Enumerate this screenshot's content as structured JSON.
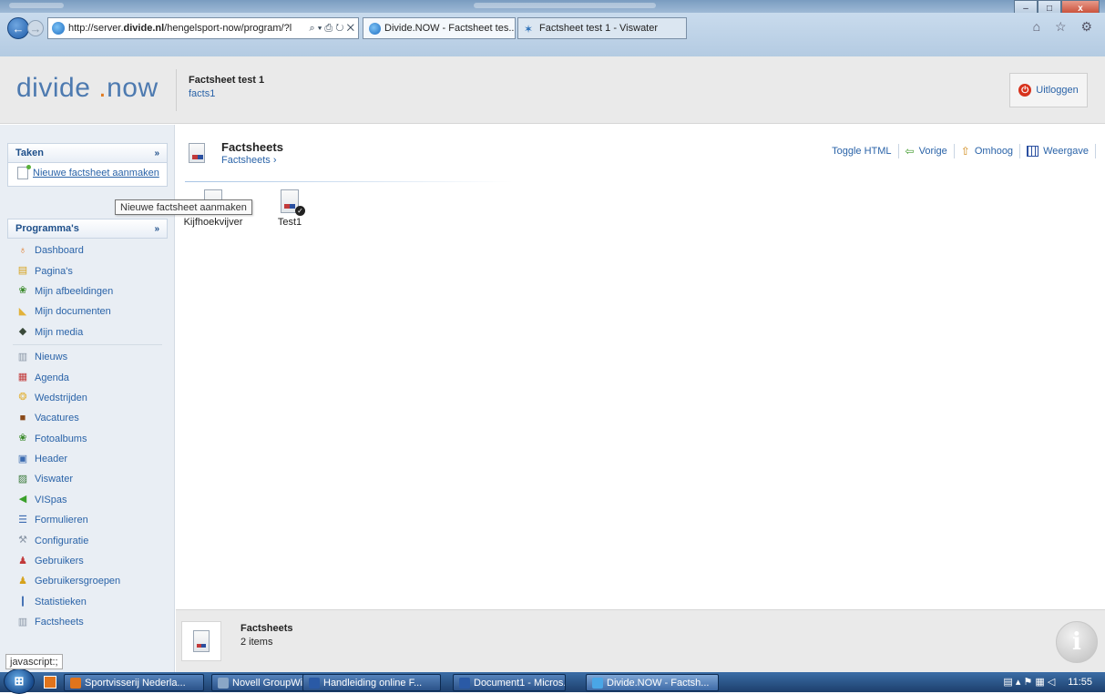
{
  "browser": {
    "url_prefix": "http://server.",
    "url_host": "divide.nl",
    "url_path": "/hengelsport-now/program/?l",
    "url_controls": "⌕ ▾ ⎙ ↻ ✕",
    "tabs": [
      {
        "label": "Divide.NOW - Factsheet tes...",
        "close": "×",
        "active": true
      },
      {
        "label": "Factsheet test 1 - Viswater",
        "active": false
      }
    ],
    "toolbar_icons": "⌂ ☆ ⚙",
    "window_buttons": {
      "minimize": "–",
      "maximize": "□",
      "close": "x"
    }
  },
  "header": {
    "logo_main": "divide",
    "logo_dot": ".",
    "logo_suffix": "now",
    "title": "Factsheet test 1",
    "subtitle": "facts1",
    "logout_label": "Uitloggen",
    "logout_icon": "⏻"
  },
  "sidebar": {
    "tasks_title": "Taken",
    "tasks_chevron": "»",
    "task_items": [
      {
        "label": "Nieuwe factsheet aanmaken",
        "icon": "new-document-icon"
      }
    ],
    "programs_title": "Programma's",
    "programs_chevron": "»",
    "program_items": [
      {
        "label": "Dashboard",
        "icon": "dashboard-icon",
        "glyph": "♁",
        "color": "#e0741c"
      },
      {
        "label": "Pagina's",
        "icon": "pages-icon",
        "glyph": "▤",
        "color": "#d6a21c"
      },
      {
        "label": "Mijn afbeeldingen",
        "icon": "images-icon",
        "glyph": "❀",
        "color": "#3a8a2a"
      },
      {
        "label": "Mijn documenten",
        "icon": "folder-icon",
        "glyph": "◣",
        "color": "#e2b23a"
      },
      {
        "label": "Mijn media",
        "icon": "media-icon",
        "glyph": "◆",
        "color": "#3a4a3a"
      },
      {
        "label": "Nieuws",
        "icon": "news-icon",
        "glyph": "▥",
        "color": "#8a96a6"
      },
      {
        "label": "Agenda",
        "icon": "calendar-icon",
        "glyph": "▦",
        "color": "#c23a3a"
      },
      {
        "label": "Wedstrijden",
        "icon": "trophy-icon",
        "glyph": "❂",
        "color": "#e2b23a"
      },
      {
        "label": "Vacatures",
        "icon": "briefcase-icon",
        "glyph": "■",
        "color": "#8a4a1a"
      },
      {
        "label": "Fotoalbums",
        "icon": "photo-album-icon",
        "glyph": "❀",
        "color": "#3a8a2a"
      },
      {
        "label": "Header",
        "icon": "header-image-icon",
        "glyph": "▣",
        "color": "#3a6ab0"
      },
      {
        "label": "Viswater",
        "icon": "viswater-icon",
        "glyph": "▨",
        "color": "#3a7a3a"
      },
      {
        "label": "VISpas",
        "icon": "vispas-icon",
        "glyph": "◀",
        "color": "#3aa02a"
      },
      {
        "label": "Formulieren",
        "icon": "forms-icon",
        "glyph": "☰",
        "color": "#3a6ab0"
      },
      {
        "label": "Configuratie",
        "icon": "configuration-icon",
        "glyph": "⚒",
        "color": "#8a96a6"
      },
      {
        "label": "Gebruikers",
        "icon": "users-icon",
        "glyph": "♟",
        "color": "#c23a3a"
      },
      {
        "label": "Gebruikersgroepen",
        "icon": "user-groups-icon",
        "glyph": "♟",
        "color": "#d6a21c"
      },
      {
        "label": "Statistieken",
        "icon": "statistics-icon",
        "glyph": "❙",
        "color": "#3a6ab0"
      },
      {
        "label": "Factsheets",
        "icon": "factsheets-icon",
        "glyph": "▥",
        "color": "#8a96a6"
      }
    ]
  },
  "tooltip": "Nieuwe factsheet aanmaken",
  "main": {
    "title": "Factsheets",
    "breadcrumb": "Factsheets ›",
    "actions": [
      {
        "label": "Toggle HTML"
      },
      {
        "label": "Vorige",
        "icon": "arrow-left-icon",
        "glyph": "⇦"
      },
      {
        "label": "Omhoog",
        "icon": "arrow-up-icon",
        "glyph": "⇧"
      },
      {
        "label": "Weergave",
        "icon": "view-grid-icon"
      }
    ],
    "files": [
      {
        "label": "Kijfhoekvijver",
        "checked": false
      },
      {
        "label": "Test1",
        "checked": true
      }
    ],
    "footer_title": "Factsheets",
    "footer_count": "2 items",
    "info_label": "i"
  },
  "statusbar": "javascript:;",
  "taskbar": {
    "start_label": "⊞",
    "items": [
      {
        "label": "Sportvisserij Nederla...",
        "color": "#e0741c"
      },
      {
        "label": "Novell GroupWise - ...",
        "color": "#8aa6c6"
      },
      {
        "label": "Handleiding online F...",
        "color": "#2a5aa6"
      },
      {
        "label": "Document1 - Micros...",
        "color": "#2a5aa6"
      },
      {
        "label": "Divide.NOW - Factsh...",
        "color": "#4aa6e6",
        "active": true
      }
    ],
    "time": "11:55",
    "tray_icons": "▤ ▴ ⚑ ▦ ◁"
  },
  "colors": {
    "accent": "#2a63a8",
    "logo": "#4d7ab0",
    "logo_dot": "#e07a20",
    "logout": "#d7321c"
  }
}
